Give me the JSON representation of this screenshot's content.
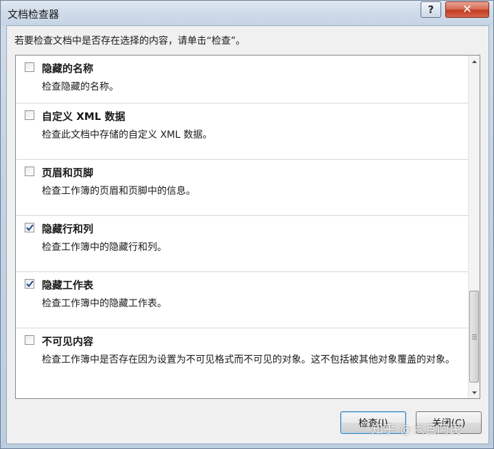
{
  "window": {
    "title": "文档检查器",
    "help_label": "?",
    "close_label": "✕"
  },
  "instruction": "若要检查文档中是否存在选择的内容，请单击“检查”。",
  "items": [
    {
      "title": "隐藏的名称",
      "description": "检查隐藏的名称。",
      "checked": false
    },
    {
      "title": "自定义 XML 数据",
      "description": "检查此文档中存储的自定义 XML 数据。",
      "checked": false
    },
    {
      "title": "页眉和页脚",
      "description": "检查工作簿的页眉和页脚中的信息。",
      "checked": false
    },
    {
      "title": "隐藏行和列",
      "description": "检查工作簿中的隐藏行和列。",
      "checked": true
    },
    {
      "title": "隐藏工作表",
      "description": "检查工作簿中的隐藏工作表。",
      "checked": true
    },
    {
      "title": "不可见内容",
      "description": "检查工作簿中是否存在因为设置为不可见格式而不可见的对象。这不包括被其他对象覆盖的对象。",
      "checked": false
    }
  ],
  "buttons": {
    "inspect_label": "检查(I)",
    "close_label": "关闭(C)"
  },
  "watermark": "知乎 @六旦阿民",
  "icons": {
    "help": "question-icon",
    "close": "close-icon",
    "check": "checkmark-icon",
    "scroll_up": "arrow-up-icon",
    "scroll_down": "arrow-down-icon"
  }
}
